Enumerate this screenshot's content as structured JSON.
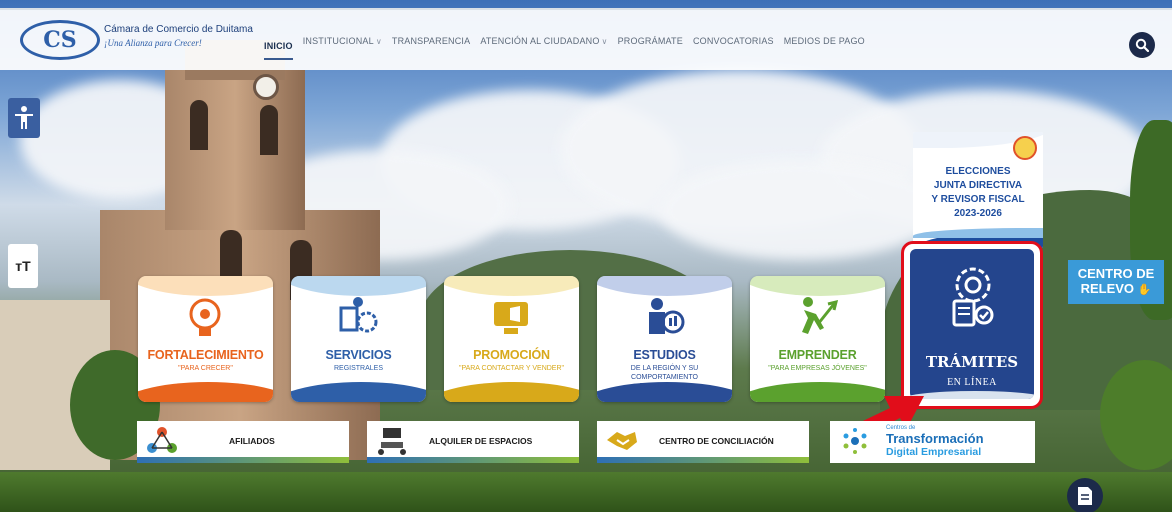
{
  "header": {
    "logo": {
      "name": "Cámara de Comercio de Duitama",
      "tagline": "¡Una Alianza para Crecer!"
    },
    "nav": [
      {
        "label": "INICIO",
        "active": true,
        "dropdown": false
      },
      {
        "label": "INSTITUCIONAL",
        "active": false,
        "dropdown": true
      },
      {
        "label": "TRANSPARENCIA",
        "active": false,
        "dropdown": false
      },
      {
        "label": "ATENCIÓN AL CIUDADANO",
        "active": false,
        "dropdown": true
      },
      {
        "label": "PROGRÁMATE",
        "active": false,
        "dropdown": false
      },
      {
        "label": "CONVOCATORIAS",
        "active": false,
        "dropdown": false
      },
      {
        "label": "MEDIOS DE PAGO",
        "active": false,
        "dropdown": false
      }
    ],
    "search_icon": "search-icon"
  },
  "side": {
    "accessibility_icon": "accessibility-icon",
    "text_size_label": "тT",
    "centro_relevo": "CENTRO DE RELEVO"
  },
  "elecciones": {
    "line1": "ELECCIONES",
    "line2": "JUNTA DIRECTIVA",
    "line3": "Y REVISOR FISCAL",
    "line4": "2023-2026"
  },
  "tiles": [
    {
      "title": "FORTALECIMIENTO",
      "subtitle": "\"PARA CRECER\"",
      "color": "#e8641e",
      "accent": "#f6a23a"
    },
    {
      "title": "SERVICIOS",
      "subtitle": "REGISTRALES",
      "color": "#2e5fa8",
      "accent": "#3b8fd0"
    },
    {
      "title": "PROMOCIÓN",
      "subtitle": "\"PARA CONTACTAR Y VENDER\"",
      "color": "#d8a91a",
      "accent": "#e8c63a"
    },
    {
      "title": "ESTUDIOS",
      "subtitle": "DE LA REGIÓN Y SU COMPORTAMIENTO EMPRESARIAL",
      "color": "#2a4d96",
      "accent": "#4d73c2"
    },
    {
      "title": "EMPRENDER",
      "subtitle": "\"PARA EMPRESAS JÓVENES\"",
      "color": "#5ba12e",
      "accent": "#8cc63f"
    }
  ],
  "tramites": {
    "title": "TRÁMITES",
    "subtitle": "EN LÍNEA",
    "highlight_color": "#e10d1a"
  },
  "banners": [
    {
      "label": "AFILIADOS"
    },
    {
      "label": "ALQUILER DE ESPACIOS"
    },
    {
      "label": "CENTRO DE CONCILIACIÓN"
    }
  ],
  "transformacion": {
    "pre": "Centros de",
    "title": "Transformación",
    "subtitle": "Digital Empresarial"
  },
  "colors": {
    "brand_blue": "#2e5fa8",
    "nav_dark": "#1c2a4a",
    "arrow_red": "#e10d1a"
  }
}
